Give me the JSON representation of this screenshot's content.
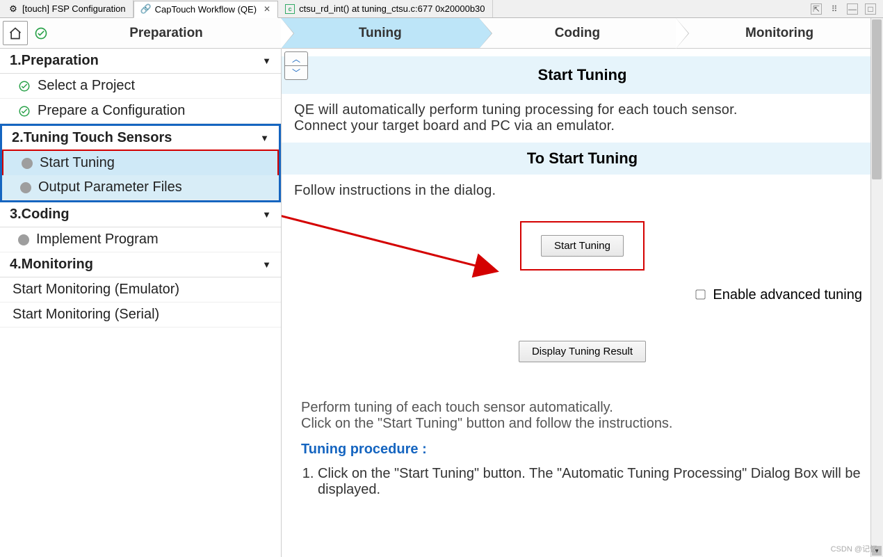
{
  "tabs": [
    {
      "label": "[touch] FSP Configuration",
      "icon": "gear"
    },
    {
      "label": "CapTouch Workflow (QE)",
      "icon": "link",
      "active": true,
      "closable": true
    },
    {
      "label": "ctsu_rd_int() at tuning_ctsu.c:677 0x20000b30",
      "icon": "c-file"
    }
  ],
  "workflow": {
    "steps": [
      "Preparation",
      "Tuning",
      "Coding",
      "Monitoring"
    ],
    "active": "Tuning"
  },
  "sidebar": {
    "sections": [
      {
        "title": "1.Preparation",
        "items": [
          {
            "label": "Select a Project",
            "ic": "check"
          },
          {
            "label": "Prepare a Configuration",
            "ic": "check"
          }
        ]
      },
      {
        "title": "2.Tuning Touch Sensors",
        "highlighted": "blue",
        "items": [
          {
            "label": "Start Tuning",
            "ic": "dot",
            "selected": true,
            "highlighted": "red"
          },
          {
            "label": "Output Parameter Files",
            "ic": "dot",
            "selected_bg": true
          }
        ]
      },
      {
        "title": "3.Coding",
        "items": [
          {
            "label": "Implement Program",
            "ic": "dot"
          }
        ]
      },
      {
        "title": "4.Monitoring",
        "items": [
          {
            "label": "Start Monitoring (Emulator)"
          },
          {
            "label": "Start Monitoring (Serial)"
          }
        ]
      }
    ]
  },
  "panel": {
    "title1": "Start Tuning",
    "desc1a": "QE will automatically perform tuning processing for each touch sensor.",
    "desc1b": "Connect your target board and PC via an emulator.",
    "title2": "To Start Tuning",
    "desc2": "Follow instructions in the dialog.",
    "start_btn": "Start Tuning",
    "adv_label": "Enable advanced tuning",
    "display_btn": "Display Tuning Result",
    "info1": "Perform tuning of each touch sensor automatically.",
    "info2": "Click on the \"Start Tuning\" button and follow the instructions.",
    "proc_head": "Tuning procedure :",
    "proc1": "Click on the \"Start Tuning\" button. The \"Automatic Tuning Processing\" Dialog Box will be displayed."
  },
  "watermark": "CSDN @记忆"
}
